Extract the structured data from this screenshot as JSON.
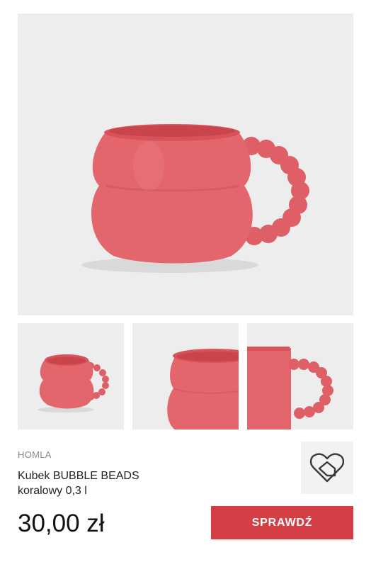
{
  "product": {
    "brand": "HOMLA",
    "title_line1": "Kubek BUBBLE BEADS",
    "title_line2": "koralowy 0,3 l",
    "price": "30,00 zł",
    "cta_label": "SPRAWDŹ"
  },
  "gallery": {
    "thumbnail_count": 3
  },
  "store_logo": {
    "icon": "heart-house-logo-icon"
  },
  "colors": {
    "mug_coral": "#e3666c",
    "cta_background": "#d33f45",
    "image_background": "#ededed"
  }
}
